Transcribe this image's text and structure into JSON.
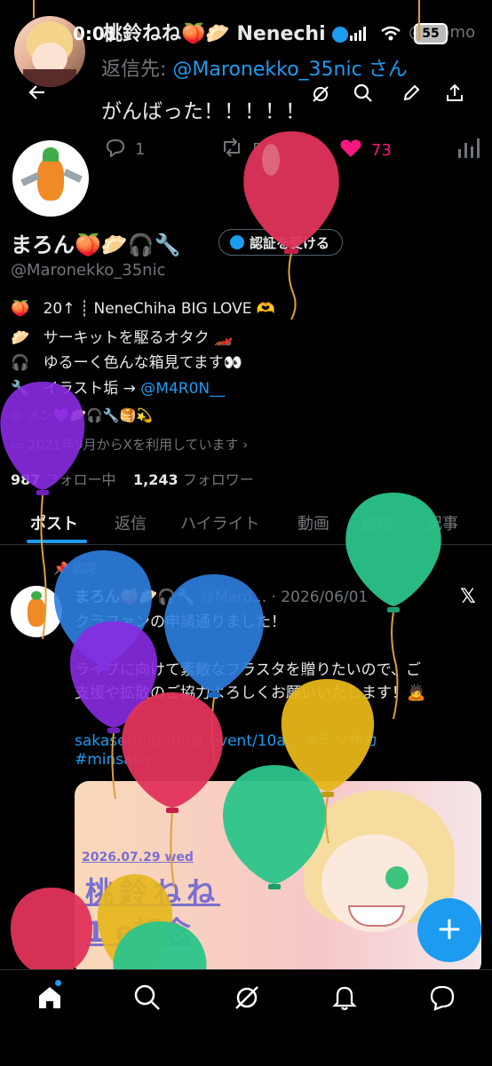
{
  "status_bar": {
    "time": "0:01",
    "battery": "55"
  },
  "peek_tweet": {
    "author": "桃鈴ねね🍑🥟 Nenechi",
    "handle": "@momo",
    "reply_prefix": "返信先:",
    "reply_to": "@Maronekko_35nic",
    "reply_suffix": "さん",
    "text": "がんばった！！！！！",
    "replies": "1",
    "retweets": "5",
    "likes": "73"
  },
  "profile": {
    "name": "まろん🍑🥟🎧🔧",
    "handle": "@Maronekko_35nic",
    "verify_button": "認証を受ける",
    "bio": [
      {
        "icon": "🍑",
        "text": "20↑ ┊ NeneChiha BIG LOVE 🫶"
      },
      {
        "icon": "🥟",
        "text": "サーキットを駆るオタク 🏎️"
      },
      {
        "icon": "🎧",
        "text": "ゆるーく色んな箱見てます👀"
      },
      {
        "icon": "🔧",
        "text": "イラスト垢 → ",
        "link": "@M4R0N__"
      }
    ],
    "location": "メン💜🥟🎧🔧🥞💫",
    "joined": "2021年9月からXを利用しています",
    "following_count": "987",
    "following_label": "フォロー中",
    "followers_count": "1,243",
    "followers_label": "フォロワー"
  },
  "tabs": [
    "ポスト",
    "返信",
    "ハイライト",
    "動画",
    "画像",
    "記事"
  ],
  "pinned_label": "固定",
  "pinned_tweet": {
    "author": "まろん🍑🥟🎧🔧",
    "handle": "@Maro...",
    "date": "· 2026/06/01",
    "line1": "クラファンの申請通りました！",
    "line2": "ライブに向けて素敵なフラスタを贈りたいので、ご",
    "line3": "支援や拡散のご協力よろしくお願いいたします！🙇",
    "url": "sakaseru.jp/mina-event/10a...",
    "hashtag1": "#ミンサカ",
    "hashtag2": "#minsaka",
    "card_date": "2026.07.29 wed",
    "card_title1": "桃鈴ねね",
    "card_title2": "1   e記念"
  },
  "colors": {
    "accent": "#1d9bf0",
    "like": "#f91880",
    "bg": "#000000"
  }
}
